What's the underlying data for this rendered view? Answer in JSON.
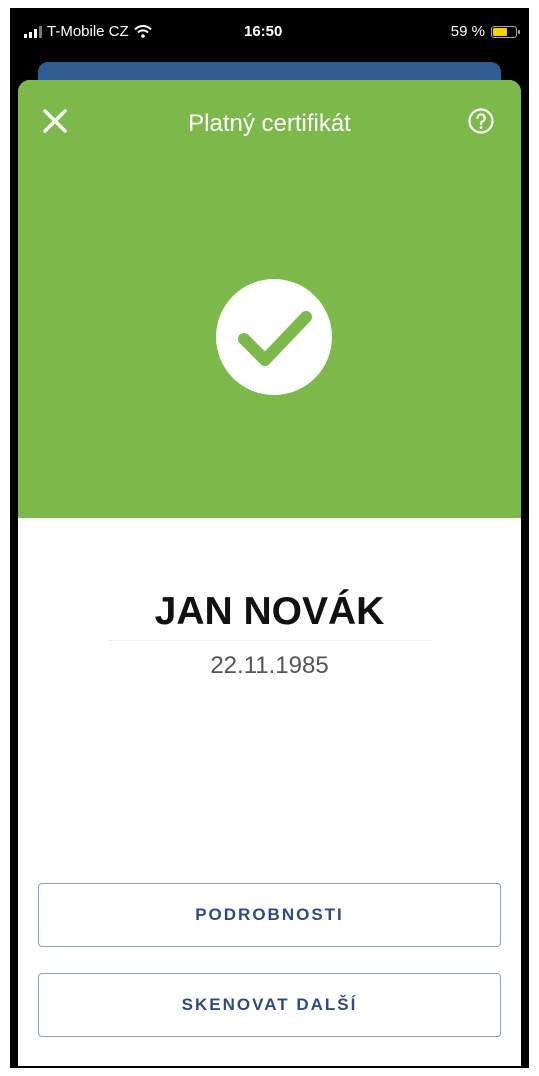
{
  "status_bar": {
    "carrier": "T-Mobile CZ",
    "time": "16:50",
    "battery": "59 %"
  },
  "header": {
    "title": "Platný certifikát",
    "background_color": "#7db94a"
  },
  "person": {
    "name": "JAN NOVÁK",
    "birth_date": "22.11.1985"
  },
  "actions": {
    "details_label": "PODROBNOSTI",
    "scan_next_label": "SKENOVAT DALŠÍ"
  },
  "icons": {
    "close": "close-icon",
    "help": "help-circle-icon",
    "valid": "check-circle-icon"
  }
}
